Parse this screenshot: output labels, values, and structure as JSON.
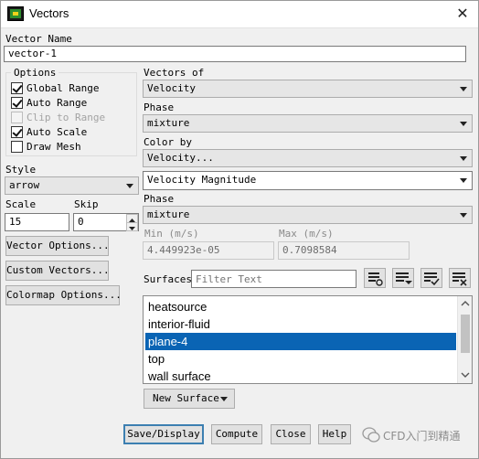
{
  "window": {
    "title": "Vectors",
    "close_glyph": "✕"
  },
  "vector_name": {
    "label": "Vector Name",
    "value": "vector-1"
  },
  "options": {
    "title": "Options",
    "items": [
      {
        "label": "Global Range",
        "checked": true,
        "enabled": true
      },
      {
        "label": "Auto Range",
        "checked": true,
        "enabled": true
      },
      {
        "label": "Clip to Range",
        "checked": false,
        "enabled": false
      },
      {
        "label": "Auto Scale",
        "checked": true,
        "enabled": true
      },
      {
        "label": "Draw Mesh",
        "checked": false,
        "enabled": true
      }
    ]
  },
  "style": {
    "label": "Style",
    "value": "arrow"
  },
  "scale": {
    "label": "Scale",
    "value": "15"
  },
  "skip": {
    "label": "Skip",
    "value": "0"
  },
  "left_buttons": {
    "vector_options": "Vector Options...",
    "custom_vectors": "Custom Vectors...",
    "colormap_options": "Colormap Options..."
  },
  "vectors_of": {
    "label": "Vectors of",
    "value": "Velocity"
  },
  "phase1": {
    "label": "Phase",
    "value": "mixture"
  },
  "color_by": {
    "label": "Color by",
    "category": "Velocity...",
    "field": "Velocity Magnitude"
  },
  "phase2": {
    "label": "Phase",
    "value": "mixture"
  },
  "min": {
    "label": "Min (m/s)",
    "value": "4.449923e-05"
  },
  "max": {
    "label": "Max (m/s)",
    "value": "0.7098584"
  },
  "surfaces": {
    "label": "Surfaces",
    "filter_placeholder": "Filter Text",
    "items": [
      "heatsource",
      "interior-fluid",
      "plane-4",
      "top",
      "wall surface"
    ],
    "selected_index": 2,
    "new_surface": "New Surface"
  },
  "footer": {
    "save_display": "Save/Display",
    "compute": "Compute",
    "close": "Close",
    "help": "Help"
  },
  "watermark": "CFD入门到精通"
}
